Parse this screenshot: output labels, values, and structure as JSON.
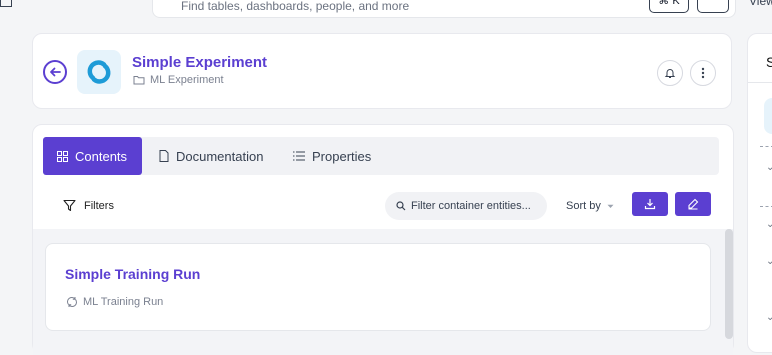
{
  "search": {
    "placeholder": "Find tables, dashboards, people, and more",
    "shortcut": "⌘ K"
  },
  "top_right": {
    "view_label": "View"
  },
  "entity": {
    "title": "Simple Experiment",
    "type_label": "ML Experiment"
  },
  "tabs": [
    {
      "label": "Contents",
      "active": true
    },
    {
      "label": "Documentation",
      "active": false
    },
    {
      "label": "Properties",
      "active": false
    }
  ],
  "toolbar": {
    "filters_label": "Filters",
    "filter_placeholder": "Filter container entities...",
    "sort_label": "Sort by"
  },
  "items": [
    {
      "title": "Simple Training Run",
      "type_label": "ML Training Run"
    }
  ],
  "right_panel": {
    "initial": "S"
  },
  "colors": {
    "accent": "#5b3fd1",
    "icon_bg": "#e6f3fb",
    "icon_fg": "#1e9bd7"
  }
}
